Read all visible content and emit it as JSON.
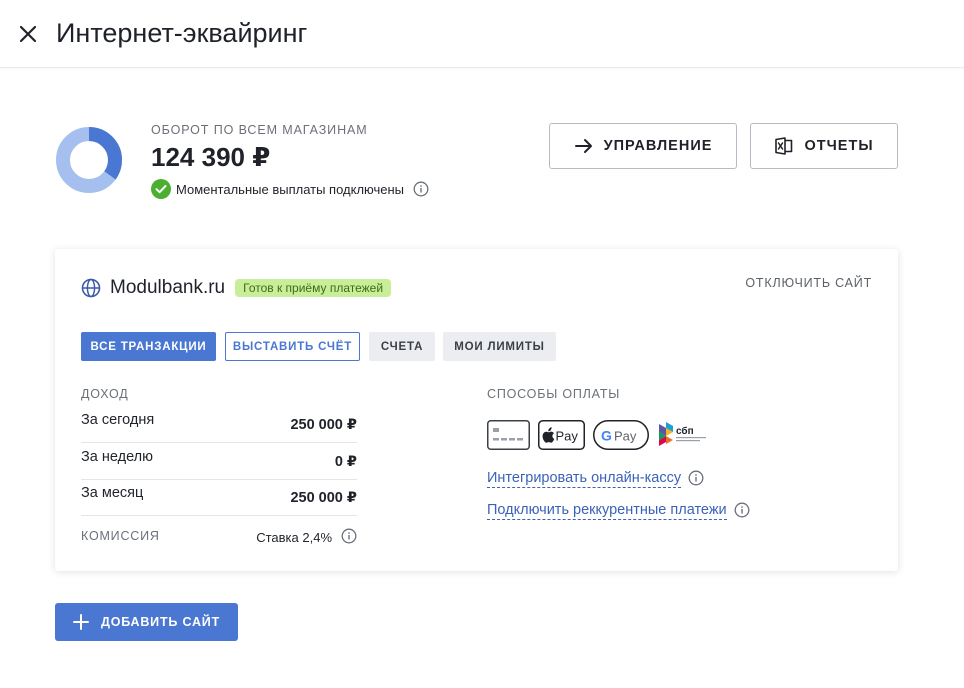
{
  "header": {
    "title": "Интернет-эквайринг",
    "close_icon": "close-icon"
  },
  "summary": {
    "turnover_label": "ОБОРОТ ПО ВСЕМ МАГАЗИНАМ",
    "turnover_value": "124 390 ₽",
    "status_text": "Моментальные выплаты подключены",
    "donut": {
      "colors": [
        "#4a77d1",
        "#a5c0ef"
      ],
      "share": 0.35
    }
  },
  "actions": {
    "manage_label": "УПРАВЛЕНИЕ",
    "reports_label": "ОТЧЕТЫ"
  },
  "site": {
    "name": "Modulbank.ru",
    "badge": "Готов к приёму платежей",
    "disable_label": "ОТКЛЮЧИТЬ САЙТ",
    "tabs": [
      {
        "label": "ВСЕ ТРАНЗАКЦИИ",
        "active": true
      },
      {
        "label": "ВЫСТАВИТЬ СЧЁТ"
      },
      {
        "label": "СЧЕТА"
      },
      {
        "label": "МОИ ЛИМИТЫ"
      }
    ],
    "income": {
      "title": "ДОХОД",
      "rows": [
        {
          "label": "За сегодня",
          "value": "250 000 ₽"
        },
        {
          "label": "За неделю",
          "value": "0 ₽"
        },
        {
          "label": "За месяц",
          "value": "250 000 ₽"
        }
      ],
      "commission_label": "КОМИССИЯ",
      "commission_rate": "Ставка 2,4%"
    },
    "payment": {
      "title": "СПОСОБЫ ОПЛАТЫ",
      "methods": [
        "card-icon",
        "apple-pay-icon",
        "google-pay-icon",
        "sbp-icon"
      ],
      "apple_pay_text": "Pay",
      "google_pay_text": "Pay",
      "sbp_text": "сбп",
      "links": [
        {
          "label": "Интегрировать онлайн-кассу"
        },
        {
          "label": "Подключить реккурентные платежи"
        }
      ]
    }
  },
  "footer": {
    "add_site_label": "ДОБАВИТЬ САЙТ"
  },
  "colors": {
    "accent": "#4a77d1",
    "success": "#4caf2f",
    "badge_bg": "#c8ee9a",
    "link": "#3a63b8"
  }
}
